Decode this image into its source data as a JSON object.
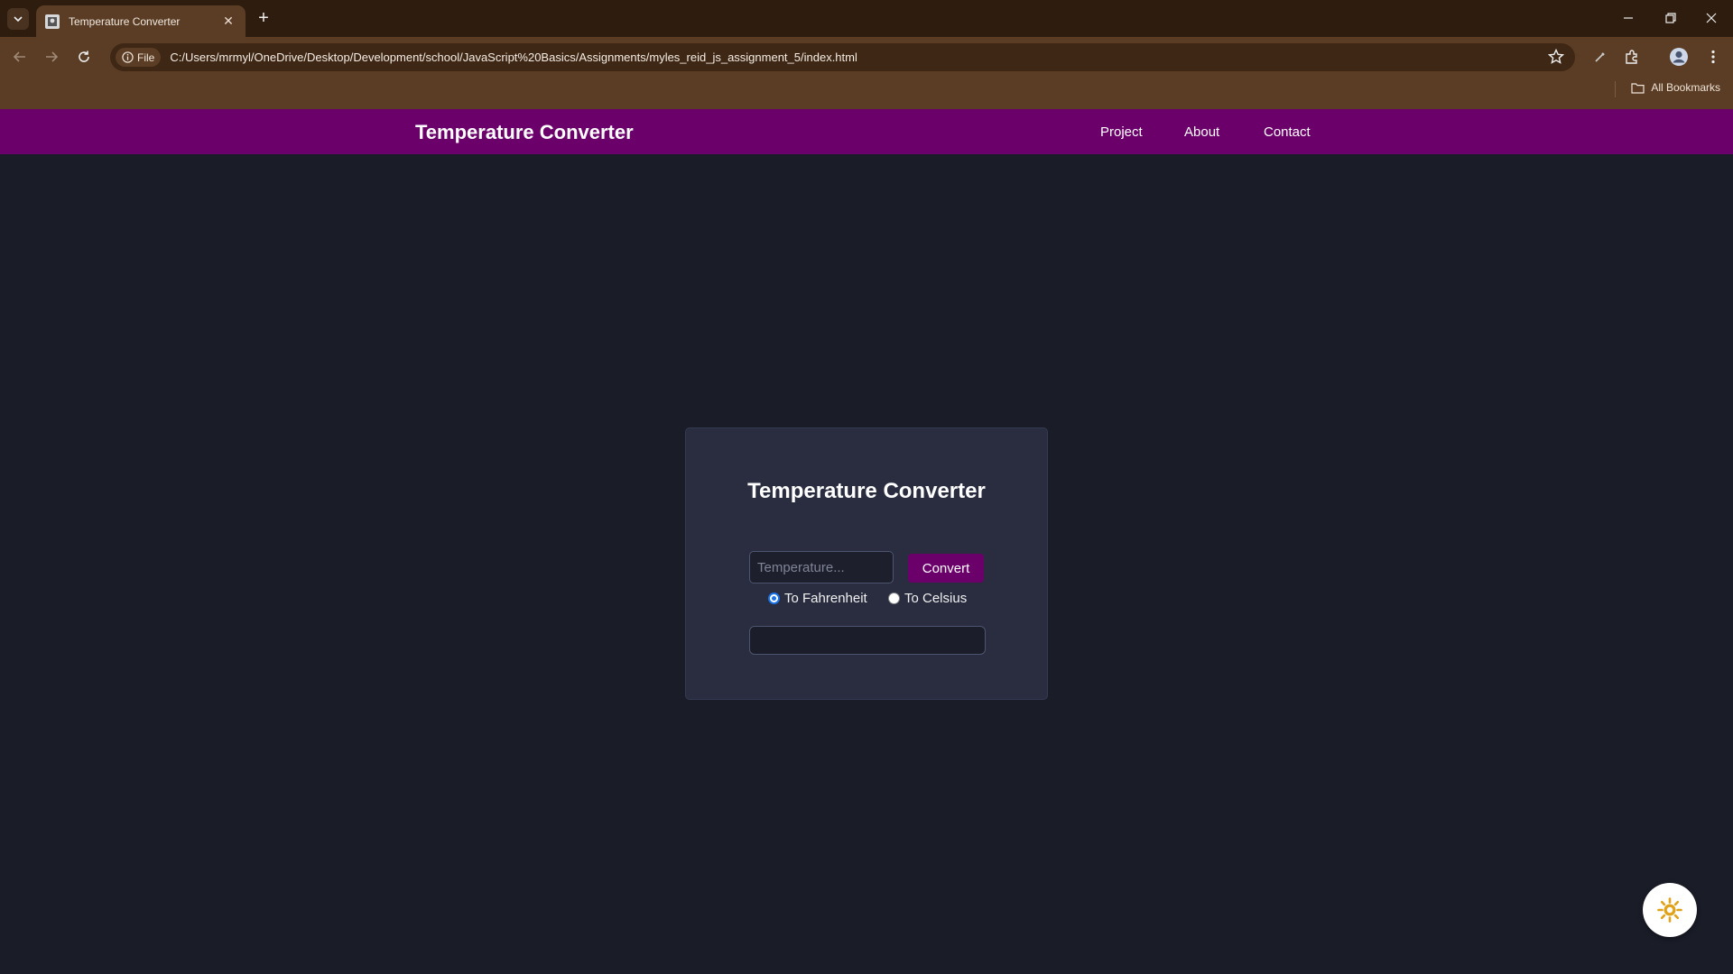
{
  "browser": {
    "tab_title": "Temperature Converter",
    "tab_close": "✕",
    "new_tab": "+",
    "site_chip": "File",
    "url": "C:/Users/mrmyl/OneDrive/Desktop/Development/school/JavaScript%20Basics/Assignments/myles_reid_js_assignment_5/index.html",
    "bookmarks_label": "All Bookmarks"
  },
  "navbar": {
    "brand": "Temperature Converter",
    "links": [
      "Project",
      "About",
      "Contact"
    ],
    "color": "#6b006b"
  },
  "converter": {
    "heading": "Temperature Converter",
    "input_placeholder": "Temperature...",
    "input_value": "",
    "convert_label": "Convert",
    "option_fahrenheit": "To Fahrenheit",
    "option_celsius": "To Celsius",
    "selected_option": "To Fahrenheit",
    "result": ""
  },
  "theme_toggle": {
    "icon": "sun-icon",
    "color": "#e0a21a"
  }
}
